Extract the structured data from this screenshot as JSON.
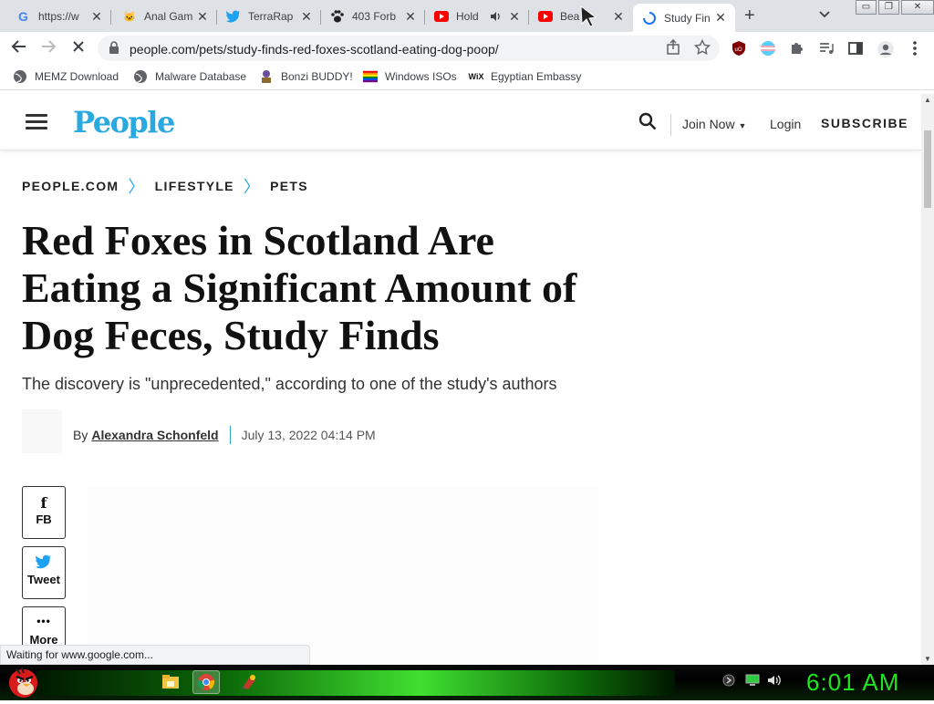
{
  "browser": {
    "tabs": [
      {
        "title": "https://w",
        "icon": "google-icon",
        "color": "#4285f4"
      },
      {
        "title": "Anal Gam",
        "icon": "cat-face-icon",
        "color": "#333333"
      },
      {
        "title": "TerraRap",
        "icon": "twitter-icon",
        "color": "#1da1f2"
      },
      {
        "title": "403 Forb",
        "icon": "paw-icon",
        "color": "#222222"
      },
      {
        "title": "Hold",
        "icon": "youtube-icon",
        "color": "#ff0000"
      },
      {
        "title": "Bea",
        "icon": "youtube-icon",
        "color": "#ff0000"
      },
      {
        "title": "Study Fin",
        "icon": "loading-spinner-icon",
        "color": "#1a73e8"
      }
    ],
    "close_glyph": "✕",
    "new_tab_glyph": "+",
    "url": "people.com/pets/study-finds-red-foxes-scotland-eating-dog-poop/",
    "bookmarks": [
      {
        "label": "MEMZ Download",
        "icon": "globe-icon"
      },
      {
        "label": "Malware Database",
        "icon": "globe-icon"
      },
      {
        "label": "Bonzi BUDDY!",
        "icon": "bonzi-icon"
      },
      {
        "label": "Windows ISOs",
        "icon": "rainbow-flag-icon"
      },
      {
        "label": "Egyptian Embassy",
        "icon": "wix-icon"
      }
    ],
    "status_text": "Waiting for www.google.com..."
  },
  "site": {
    "logo": "People",
    "brand_color": "#29a9e0",
    "nav": {
      "join": "Join Now",
      "login": "Login",
      "subscribe": "SUBSCRIBE"
    },
    "breadcrumbs": [
      "PEOPLE.COM",
      "LIFESTYLE",
      "PETS"
    ],
    "breadcrumb_separator": "〉"
  },
  "article": {
    "headline": "Red Foxes in Scotland Are Eating a Significant Amount of Dog Feces, Study Finds",
    "dek": "The discovery is \"unprecedented,\" according to one of the study's authors",
    "by_prefix": "By",
    "author": "Alexandra Schonfeld",
    "date": "July 13, 2022 04:14 PM",
    "share": [
      {
        "label": "FB",
        "icon": "facebook-icon",
        "glyph": "f",
        "color": "#3b5998"
      },
      {
        "label": "Tweet",
        "icon": "twitter-icon",
        "glyph": "🐦",
        "color": "#1da1f2"
      },
      {
        "label": "More",
        "icon": "more-dots-icon",
        "glyph": "•••",
        "color": "#111111"
      }
    ]
  },
  "taskbar": {
    "clock": "6:01 AM",
    "clock_color": "#1ee61e"
  }
}
